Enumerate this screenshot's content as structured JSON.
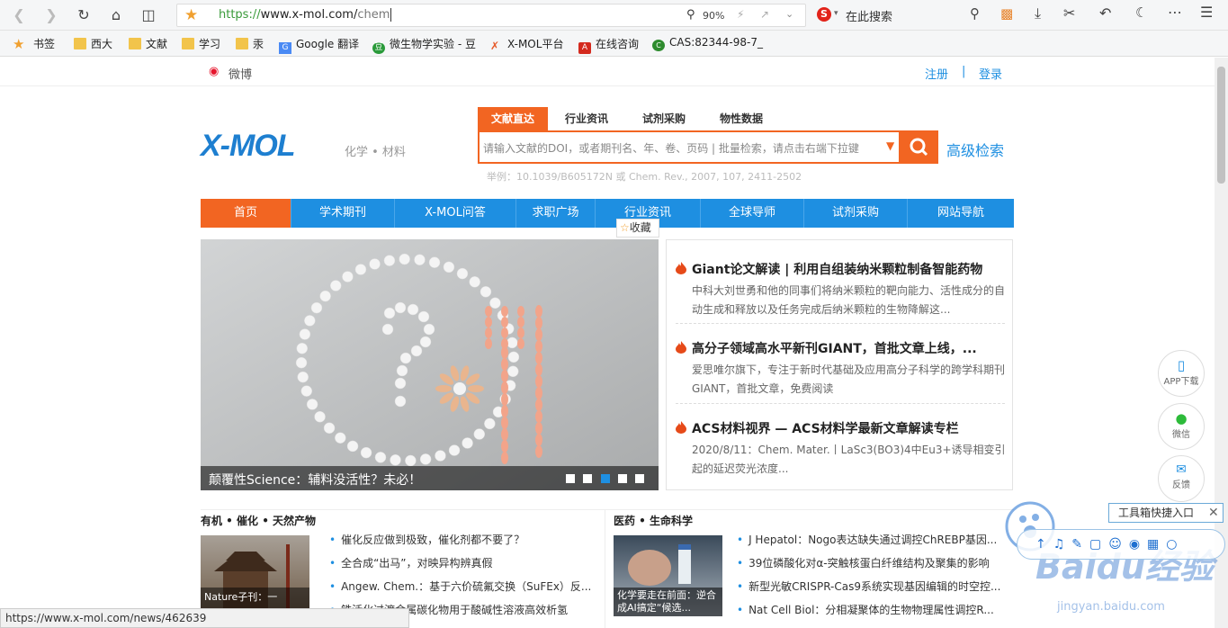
{
  "browser": {
    "url_https": "https://",
    "url_host": "www.x-mol.com/",
    "url_path": "chem",
    "zoom": "90%",
    "search_engine_placeholder": "在此搜索"
  },
  "bookmarks": [
    {
      "label": "书签",
      "icon": "star-icon"
    },
    {
      "label": "西大",
      "icon": "folder-icon"
    },
    {
      "label": "文献",
      "icon": "folder-icon"
    },
    {
      "label": "学习",
      "icon": "folder-icon"
    },
    {
      "label": "汞",
      "icon": "folder-icon"
    },
    {
      "label": "Google 翻译",
      "icon": "google-translate-icon"
    },
    {
      "label": "微生物学实验 - 豆",
      "icon": "douban-icon"
    },
    {
      "label": "X-MOL平台",
      "icon": "xmol-icon"
    },
    {
      "label": "在线咨询",
      "icon": "pdf-icon"
    },
    {
      "label": "CAS:82344-98-7_",
      "icon": "cas-icon"
    }
  ],
  "topbar": {
    "weibo": "微博",
    "register": "注册",
    "divider": "|",
    "login": "登录"
  },
  "logo": {
    "text": "X-MOL",
    "tagline": "化学 • 材料"
  },
  "search": {
    "tabs": [
      "文献直达",
      "行业资讯",
      "试剂采购",
      "物性数据"
    ],
    "placeholder": "请输入文献的DOI，或者期刊名、年、卷、页码 | 批量检索，请点击右端下拉键",
    "advanced": "高级检索",
    "example": "举例：10.1039/B605172N 或 Chem. Rev., 2007, 107, 2411-2502"
  },
  "nav": [
    "首页",
    "学术期刊",
    "X-MOL问答",
    "求职广场",
    "行业资讯",
    "全球导师",
    "试剂采购",
    "网站导航"
  ],
  "favorite": "收藏",
  "banner": {
    "caption": "颠覆性Science：辅料没活性？未必！",
    "dots": 5,
    "active_dot": 3
  },
  "news": [
    {
      "title": "Giant论文解读 | 利用自组装纳米颗粒制备智能药物",
      "desc": "中科大刘世勇和他的同事们将纳米颗粒的靶向能力、活性成分的自动生成和释放以及任务完成后纳米颗粒的生物降解这..."
    },
    {
      "title": "高分子领域高水平新刊GIANT，首批文章上线，...",
      "desc": "爱思唯尔旗下，专注于新时代基础及应用高分子科学的跨学科期刊GIANT，首批文章，免费阅读"
    },
    {
      "title": "ACS材料视界 — ACS材料学最新文章解读专栏",
      "desc": "2020/8/11：Chem. Mater.丨LaSc3(BO3)4中Eu3+诱导相变引起的延迟荧光浓度..."
    }
  ],
  "float_buttons": [
    "APP下载",
    "微信",
    "反馈"
  ],
  "sections": [
    {
      "title": "有机 • 催化 • 天然产物",
      "thumb_caption": "Nature子刊：一",
      "items": [
        "催化反应做到极致，催化剂都不要了？",
        "全合成“出马”，对映异构辨真假",
        "Angew. Chem.：基于六价硫氟交换（SuFEx）反...",
        "铁活化过渡金属碳化物用于酸碱性溶液高效析氢"
      ]
    },
    {
      "title": "医药 • 生命科学",
      "thumb_caption": "化学要走在前面：逆合成AI搞定“候选...",
      "items": [
        "J Hepatol：Nogo表达缺失通过调控ChREBP基因...",
        "39位磷酸化对α-突触核蛋白纤维结构及聚集的影响",
        "新型光敏CRISPR-Cas9系统实现基因编辑的时空控...",
        "Nat Cell Biol：分相凝聚体的生物物理属性调控R..."
      ]
    }
  ],
  "status_url": "https://www.x-mol.com/news/462639",
  "toolbox": "工具箱快捷入口",
  "watermark": "Baidu经验",
  "watermark_sub": "jingyan.baidu.com",
  "colors": {
    "accent": "#f26522",
    "nav": "#1e8fe1",
    "link": "#1e8fe1"
  }
}
